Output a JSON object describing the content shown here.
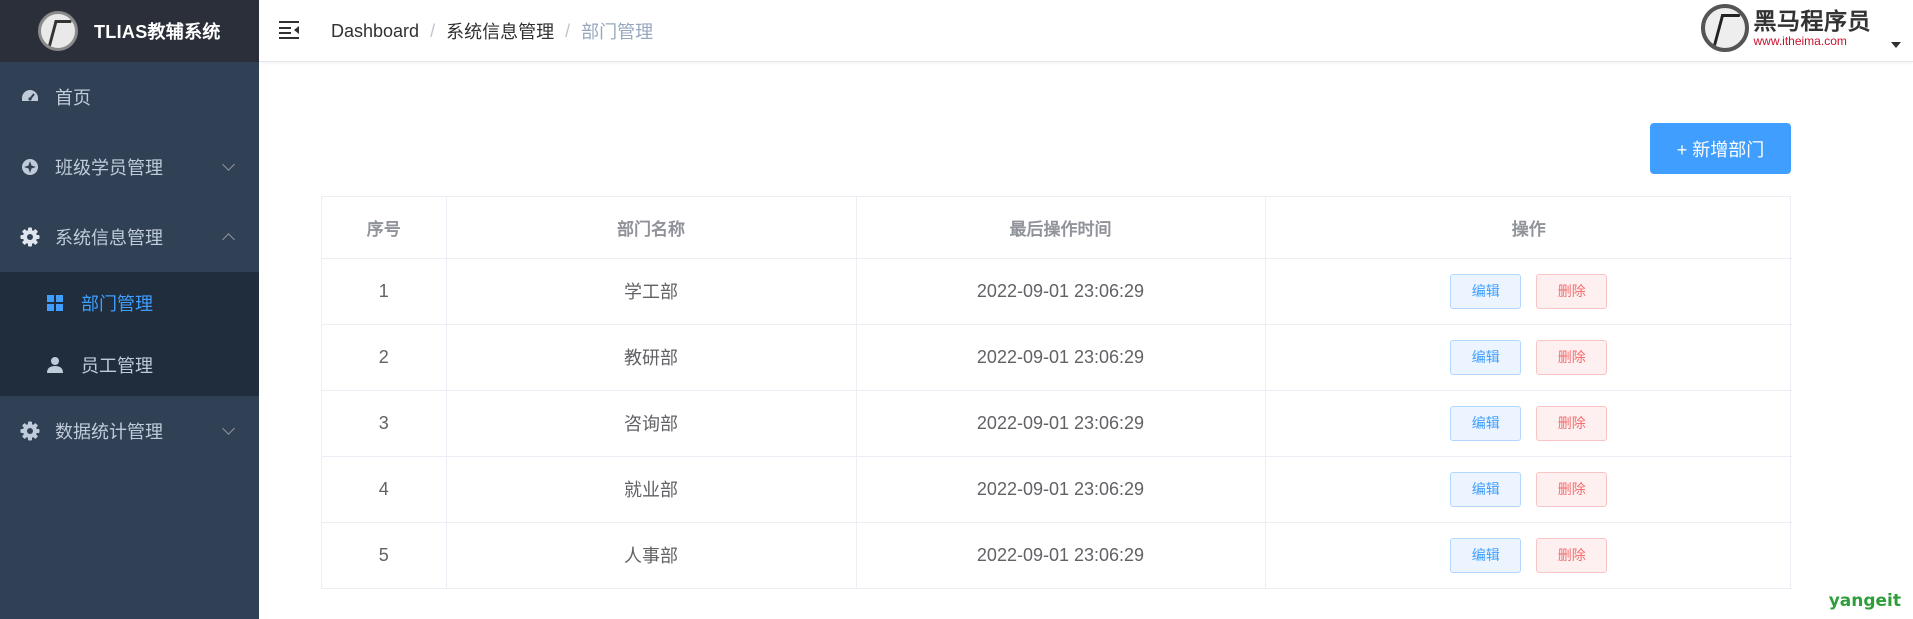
{
  "app": {
    "title": "TLIAS教辅系统"
  },
  "sidebar": {
    "items": [
      {
        "label": "首页",
        "icon": "dashboard-icon"
      },
      {
        "label": "班级学员管理",
        "icon": "aim-icon",
        "expanded": false
      },
      {
        "label": "系统信息管理",
        "icon": "gear-icon",
        "expanded": true,
        "children": [
          {
            "label": "部门管理",
            "icon": "grid-icon",
            "active": true
          },
          {
            "label": "员工管理",
            "icon": "user-icon",
            "active": false
          }
        ]
      },
      {
        "label": "数据统计管理",
        "icon": "gear-icon",
        "expanded": false
      }
    ]
  },
  "header": {
    "breadcrumb": [
      "Dashboard",
      "系统信息管理",
      "部门管理"
    ],
    "brand_title": "黑马程序员",
    "brand_url": "www.itheima.com"
  },
  "main": {
    "add_button": "+ 新增部门",
    "table": {
      "columns": [
        "序号",
        "部门名称",
        "最后操作时间",
        "操作"
      ],
      "rows": [
        {
          "index": "1",
          "name": "学工部",
          "time": "2022-09-01 23:06:29"
        },
        {
          "index": "2",
          "name": "教研部",
          "time": "2022-09-01 23:06:29"
        },
        {
          "index": "3",
          "name": "咨询部",
          "time": "2022-09-01 23:06:29"
        },
        {
          "index": "4",
          "name": "就业部",
          "time": "2022-09-01 23:06:29"
        },
        {
          "index": "5",
          "name": "人事部",
          "time": "2022-09-01 23:06:29"
        }
      ],
      "edit_label": "编辑",
      "delete_label": "删除"
    }
  },
  "watermark": "yangeit",
  "colors": {
    "sidebar_bg": "#304156",
    "logo_bg": "#2b2f3a",
    "submenu_bg": "#1f2d3d",
    "primary": "#409eff",
    "danger": "#f56c6c"
  }
}
